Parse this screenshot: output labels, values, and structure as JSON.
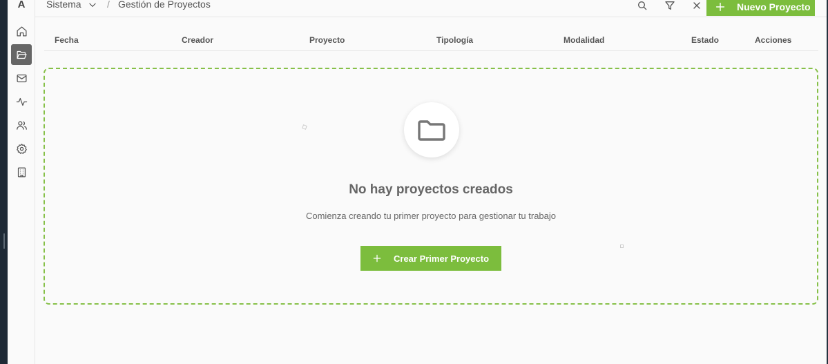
{
  "app": {
    "logo": "A"
  },
  "sidebar": {
    "items": [
      {
        "name": "home-icon",
        "active": false
      },
      {
        "name": "folder-open-icon",
        "active": true
      },
      {
        "name": "mail-icon",
        "active": false
      },
      {
        "name": "activity-icon",
        "active": false
      },
      {
        "name": "users-icon",
        "active": false
      },
      {
        "name": "settings-icon",
        "active": false
      },
      {
        "name": "building-icon",
        "active": false
      }
    ]
  },
  "header": {
    "breadcrumb_root": "Sistema",
    "breadcrumb_sep": "/",
    "breadcrumb_page": "Gestión de Proyectos",
    "new_button_label": "Nuevo Proyecto"
  },
  "table": {
    "columns": [
      "Fecha",
      "Creador",
      "Proyecto",
      "Tipología",
      "Modalidad",
      "Estado",
      "Acciones"
    ]
  },
  "empty_state": {
    "title": "No hay proyectos creados",
    "subtitle": "Comienza creando tu primer proyecto para gestionar tu trabajo",
    "button_label": "Crear Primer Proyecto"
  },
  "colors": {
    "accent": "#7cbd3d",
    "active_nav": "#666666",
    "background": "#fafafa"
  }
}
